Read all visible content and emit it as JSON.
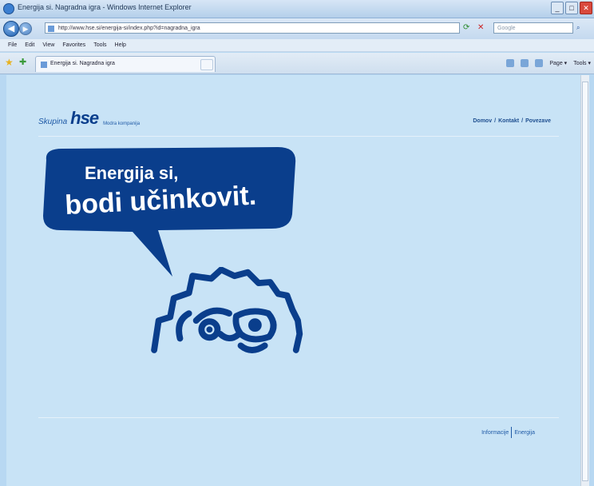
{
  "window": {
    "title": "Energija si. Nagradna igra - Windows Internet Explorer",
    "controls": {
      "minimize": "_",
      "maximize": "□",
      "close": "✕"
    }
  },
  "address_bar": {
    "url": "http://www.hse.si/energija-si/index.php?id=nagradna_igra",
    "search_placeholder": "Google",
    "back_icon": "arrow-left-icon",
    "forward_icon": "arrow-right-icon"
  },
  "menu": [
    "File",
    "Edit",
    "View",
    "Favorites",
    "Tools",
    "Help"
  ],
  "tab": {
    "label": "Energija si. Nagradna igra"
  },
  "command_bar": {
    "page_label": "Page ▾",
    "tools_label": "Tools ▾"
  },
  "page": {
    "brand_group": "Skupina",
    "brand_logo": "hse",
    "brand_sub": "Modra kompanija",
    "top_nav": [
      "Domov",
      "Kontakt",
      "Povezave"
    ],
    "top_nav_sep": "/",
    "bubble_line1": "Energija si,",
    "bubble_line2": "bodi učinkovit.",
    "bottom_nav": [
      "Informacije",
      "Energija"
    ],
    "colors": {
      "brand_blue": "#0a3e8c",
      "background": "#c8e3f6"
    }
  }
}
